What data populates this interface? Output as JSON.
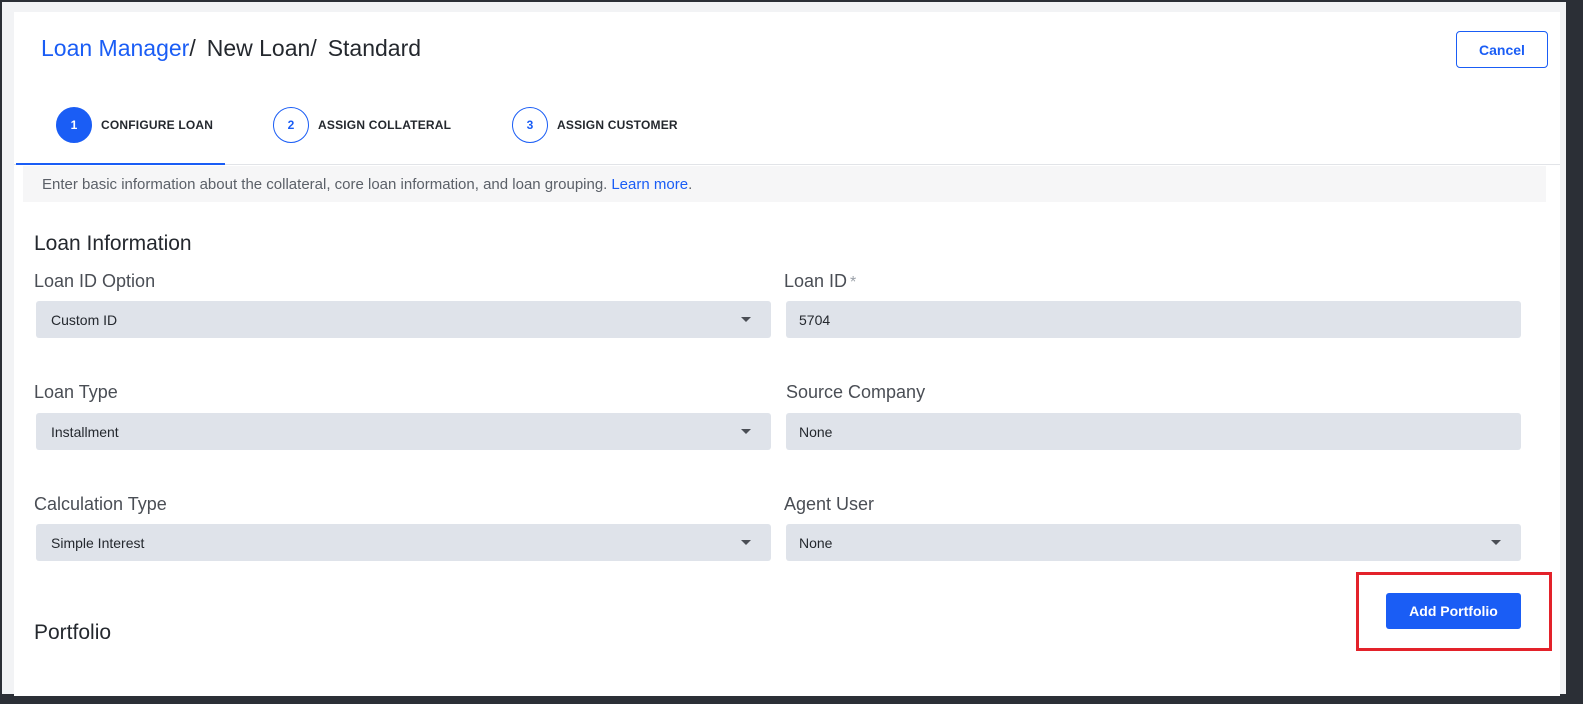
{
  "breadcrumb": {
    "root": "Loan Manager",
    "level1": "New Loan",
    "level2": "Standard",
    "separator": "/"
  },
  "header": {
    "cancel_label": "Cancel"
  },
  "stepper": {
    "steps": [
      {
        "number": "1",
        "label": "CONFIGURE LOAN",
        "active": true
      },
      {
        "number": "2",
        "label": "ASSIGN COLLATERAL",
        "active": false
      },
      {
        "number": "3",
        "label": "ASSIGN CUSTOMER",
        "active": false
      }
    ]
  },
  "intro": {
    "text": "Enter basic information about the collateral, core loan information, and loan grouping.",
    "link": "Learn more",
    "suffix": "."
  },
  "loan_information": {
    "title": "Loan Information",
    "loan_id_option": {
      "label": "Loan ID Option",
      "value": "Custom ID"
    },
    "loan_id": {
      "label": "Loan ID",
      "required_mark": "*",
      "value": "5704"
    },
    "loan_type": {
      "label": "Loan Type",
      "value": "Installment"
    },
    "source_company": {
      "label": "Source Company",
      "value": "None"
    },
    "calculation_type": {
      "label": "Calculation Type",
      "value": "Simple Interest"
    },
    "agent_user": {
      "label": "Agent User",
      "value": "None"
    }
  },
  "portfolio": {
    "title": "Portfolio",
    "add_label": "Add Portfolio"
  },
  "colors": {
    "accent": "#1a5df5",
    "highlight": "#e3222a",
    "field_bg": "#dfe3ea"
  }
}
